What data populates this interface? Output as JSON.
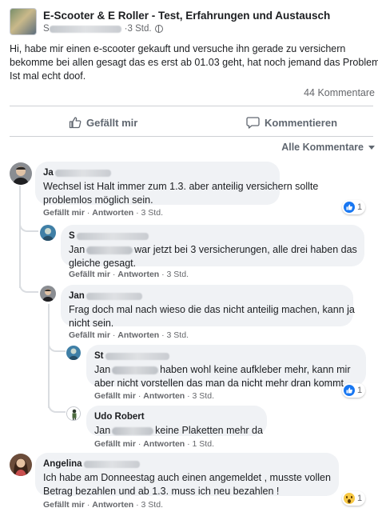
{
  "post": {
    "group_name": "E-Scooter & E Roller - Test, Erfahrungen und Austausch",
    "author_prefix": "S",
    "time": "3 Std.",
    "text_lines": [
      "Hi, habe mir einen e-scooter gekauft und versuche ihn gerade zu versichern",
      "bekomme bei allen gesagt das es erst ab 01.03 geht, hat noch jemand das Problem?",
      "Ist mal echt doof."
    ],
    "comment_count": "44 Kommentare"
  },
  "actions": {
    "like_label": "Gefällt mir",
    "comment_label": "Kommentieren"
  },
  "filter_label": "Alle Kommentare",
  "comments": [
    {
      "author": "Ja",
      "lines": [
        "Wechsel ist Halt immer zum 1.3. aber anteilig versichern sollte",
        "problemlos möglich sein."
      ],
      "like": "Gefällt mir",
      "reply": "Antworten",
      "time": "3 Std.",
      "reaction_count": "1"
    },
    {
      "author": "S",
      "line1_prefix": "Jan",
      "line1_suffix": "war jetzt bei 3 versicherungen, alle drei haben das",
      "line2": "gleiche gesagt.",
      "like": "Gefällt mir",
      "reply": "Antworten",
      "time": "3 Std."
    },
    {
      "author": "Jan",
      "lines": [
        "Frag doch mal nach wieso die das nicht anteilig machen, kann ja",
        "nicht sein."
      ],
      "like": "Gefällt mir",
      "reply": "Antworten",
      "time": "3 Std."
    },
    {
      "author": "St",
      "line1_prefix": "Jan",
      "line1_suffix": "haben wohl keine aufkleber mehr, kann mir",
      "line2": "aber nicht vorstellen das man da nicht mehr dran kommt.",
      "like": "Gefällt mir",
      "reply": "Antworten",
      "time": "3 Std.",
      "reaction_count": "1"
    },
    {
      "author": "Udo Robert",
      "line1_prefix": "Jan",
      "line1_suffix": "keine Plaketten mehr da",
      "like": "Gefällt mir",
      "reply": "Antworten",
      "time": "1 Std."
    },
    {
      "author": "Angelina",
      "lines": [
        "Ich habe am Donneestag auch einen angemeldet , musste vollen",
        "Betrag bezahlen und ab 1.3. muss ich neu bezahlen !"
      ],
      "like": "Gefällt mir",
      "reply": "Antworten",
      "time": "3 Std.",
      "reaction_count": "1"
    }
  ],
  "colors": {
    "like_blue": "#1877f2",
    "bubble": "#f0f2f5",
    "meta_gray": "#65676b"
  }
}
